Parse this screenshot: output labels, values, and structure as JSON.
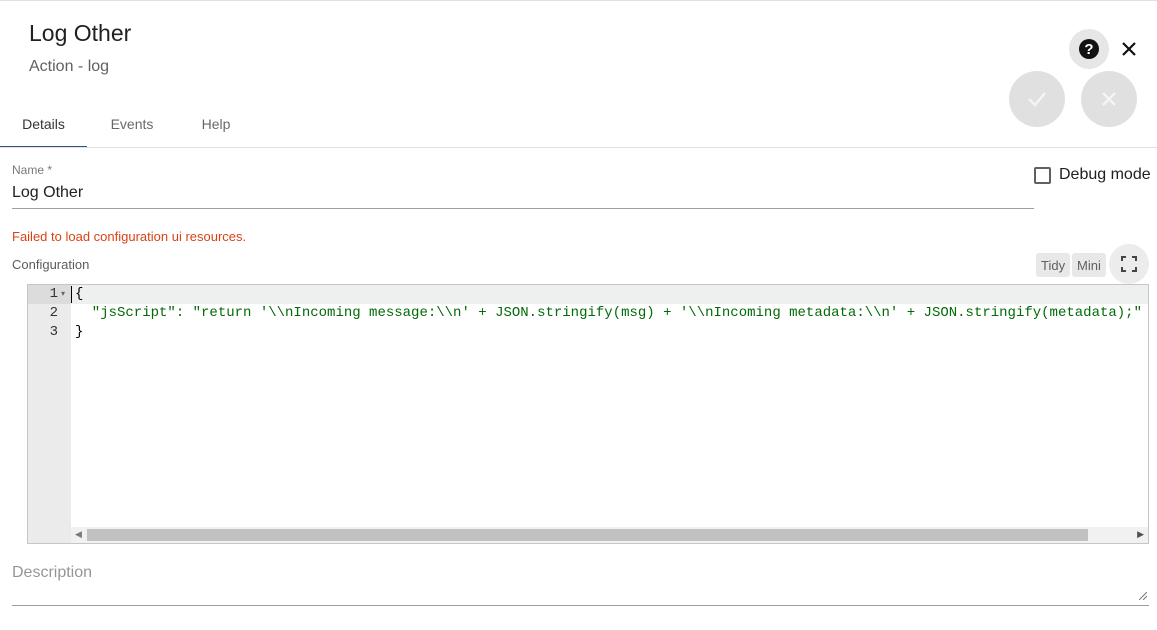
{
  "header": {
    "title": "Log Other",
    "subtitle": "Action - log",
    "help_icon": "help-circle-icon",
    "close_icon": "close-icon",
    "apply_icon": "check-icon",
    "cancel_icon": "close-icon"
  },
  "tabs": [
    {
      "label": "Details",
      "active": true
    },
    {
      "label": "Events",
      "active": false
    },
    {
      "label": "Help",
      "active": false
    }
  ],
  "form": {
    "name": {
      "label": "Name *",
      "value": "Log Other"
    },
    "debug": {
      "label": "Debug mode",
      "checked": false
    },
    "error": "Failed to load configuration ui resources.",
    "config_label": "Configuration",
    "tidy_label": "Tidy",
    "mini_label": "Mini",
    "fullscreen_icon": "fullscreen-icon",
    "description_placeholder": "Description"
  },
  "editor": {
    "line_numbers": [
      "1",
      "2",
      "3"
    ],
    "lines": [
      "{",
      "  \"jsScript\": \"return '\\\\nIncoming message:\\\\n' + JSON.stringify(msg) + '\\\\nIncoming metadata:\\\\n' + JSON.stringify(metadata);\"",
      "}"
    ]
  },
  "colors": {
    "tab_indicator": "#305680",
    "error": "#d84315",
    "fab_bg": "#e0e0e0"
  }
}
